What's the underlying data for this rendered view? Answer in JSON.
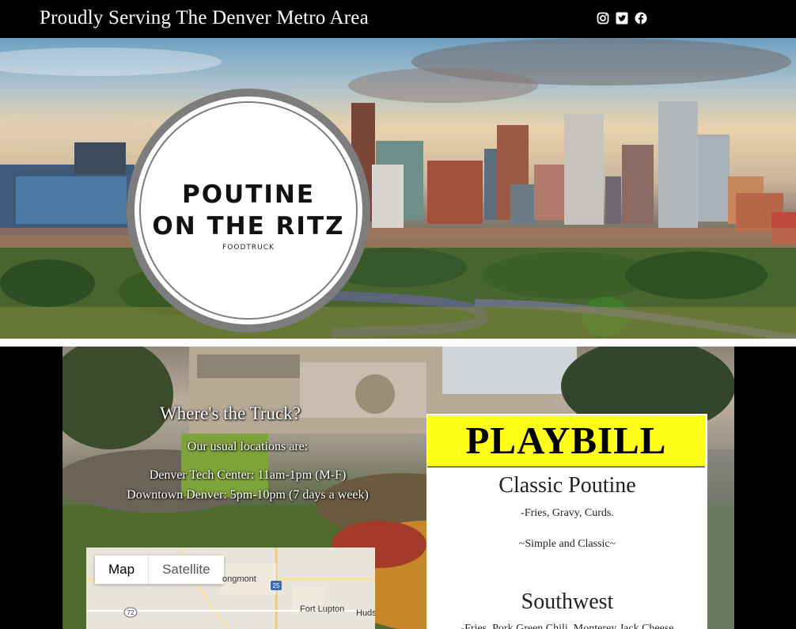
{
  "header": {
    "tagline": "Proudly Serving The Denver Metro Area",
    "social_icons": [
      "instagram-icon",
      "twitter-icon",
      "facebook-icon"
    ]
  },
  "logo": {
    "line1": "POUTINE",
    "line2": "ON THE RITZ",
    "line3": "FOODTRUCK"
  },
  "truck": {
    "title": "Where's the Truck?",
    "intro": "Our usual locations are:",
    "location1": "Denver Tech Center: 11am-1pm (M-F)",
    "location2": "Downtown Denver: 5pm-10pm (7 days a week)"
  },
  "map": {
    "tabs": [
      "Map",
      "Satellite"
    ],
    "active_tab": "Map",
    "labels": [
      "ongmont",
      "Fort Lupton",
      "Huds",
      "25",
      "72"
    ]
  },
  "menu": {
    "header": "PLAYBILL",
    "items": [
      {
        "name": "Classic Poutine",
        "lines": [
          "-Fries, Gravy, Curds.",
          "~Simple and Classic~"
        ]
      },
      {
        "name": "Southwest",
        "lines": [
          "-Fries, Pork Green Chili, Monterey Jack Cheese"
        ]
      }
    ]
  },
  "colors": {
    "topbar": "#000000",
    "playbill_header": "#ffff1a",
    "logo_ring": "#7d7d7d"
  }
}
